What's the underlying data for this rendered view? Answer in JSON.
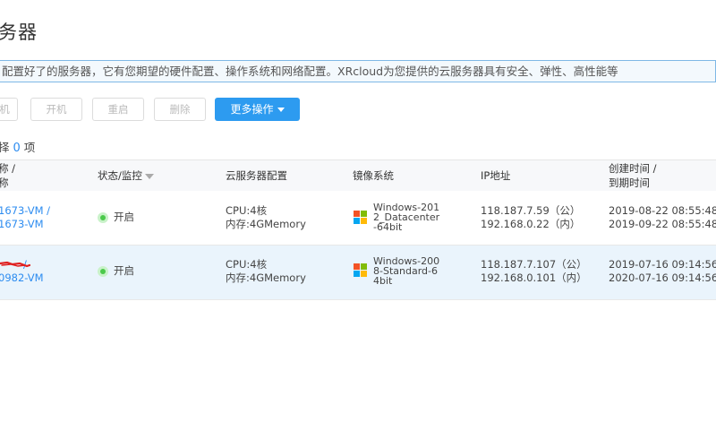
{
  "page": {
    "title": "务器"
  },
  "notice": {
    "text": "配置好了的服务器，它有您期望的硬件配置、操作系统和网络配置。XRcloud为您提供的云服务器具有安全、弹性、高性能等"
  },
  "toolbar": {
    "btn_partial": "机",
    "start_label": "开机",
    "restart_label": "重启",
    "delete_label": "删除",
    "more_label": "更多操作"
  },
  "selection": {
    "prefix": "择",
    "count": "0",
    "suffix": "项"
  },
  "table": {
    "headers": {
      "name_line1": "称 /",
      "name_line2": "称",
      "status": "状态/监控",
      "config": "云服务器配置",
      "image": "镜像系统",
      "ip": "IP地址",
      "time_line1": "创建时间 /",
      "time_line2": "到期时间"
    },
    "rows": [
      {
        "name_line1": "1673-VM /",
        "name_line2": "1673-VM",
        "status": "开启",
        "cpu": "CPU:4核",
        "mem": "内存:4GMemory",
        "image_line1": "Windows-201",
        "image_line2": "2_Datacenter",
        "image_line3": "-64bit",
        "ip_public": "118.187.7.59（公）",
        "ip_private": "192.168.0.22（内）",
        "created": "2019-08-22 08:55:48",
        "expires": "2019-09-22 08:55:48"
      },
      {
        "name_line1": "/",
        "name_line2": "0982-VM",
        "status": "开启",
        "cpu": "CPU:4核",
        "mem": "内存:4GMemory",
        "image_line1": "Windows-200",
        "image_line2": "8-Standard-6",
        "image_line3": "4bit",
        "ip_public": "118.187.7.107（公）",
        "ip_private": "192.168.0.101（内）",
        "created": "2019-07-16 09:14:56",
        "expires": "2020-07-16 09:14:56"
      }
    ]
  },
  "colors": {
    "accent": "#2d9bf0",
    "status_on": "#4bc94b",
    "selected_row": "#eaf4fc",
    "annotation": "#e02020"
  }
}
